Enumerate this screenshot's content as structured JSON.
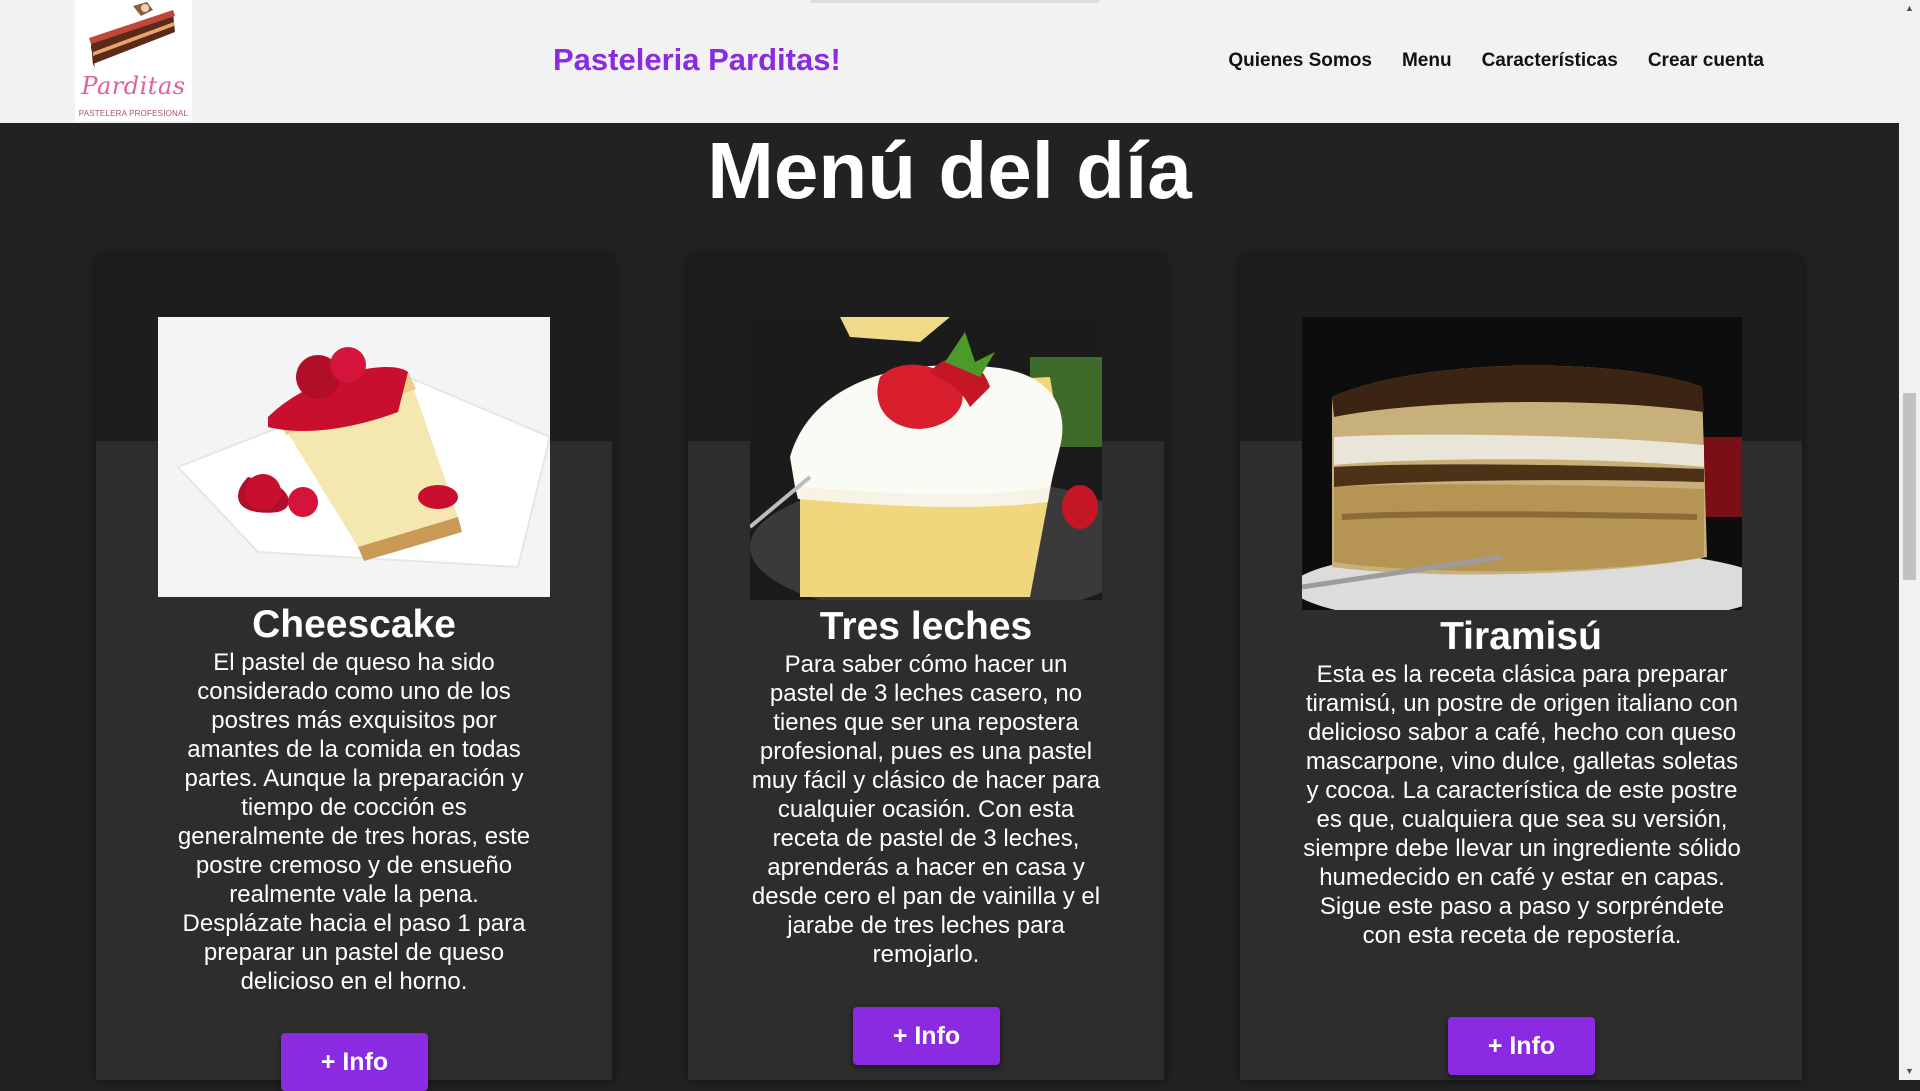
{
  "header": {
    "logo_text": "Parditas",
    "logo_subtext": "PASTELERA PROFESIONAL",
    "brand": "Pasteleria Parditas!",
    "nav": [
      "Quienes Somos",
      "Menu",
      "Características",
      "Crear cuenta"
    ]
  },
  "main": {
    "title": "Menú del día",
    "cards": [
      {
        "image": "cheesecake-photo",
        "title": "Cheescake",
        "text": "El pastel de queso ha sido considerado como uno de los postres más exquisitos por amantes de la comida en todas partes. Aunque la preparación y tiempo de cocción es generalmente de tres horas, este postre cremoso y de ensueño realmente vale la pena. Desplázate hacia el paso 1 para preparar un pastel de queso delicioso en el horno.",
        "button": "+ Info"
      },
      {
        "image": "tres-leches-photo",
        "title": "Tres leches",
        "text": "Para saber cómo hacer un pastel de 3 leches casero, no tienes que ser una repostera profesional, pues es una pastel muy fácil y clásico de hacer para cualquier ocasión. Con esta receta de pastel de 3 leches, aprenderás a hacer en casa y desde cero el pan de vainilla y el jarabe de tres leches para remojarlo.",
        "button": "+ Info"
      },
      {
        "image": "tiramisu-photo",
        "title": "Tiramisú",
        "text": "Esta es la receta clásica para preparar tiramisú, un postre de origen italiano con delicioso sabor a café, hecho con queso mascarpone, vino dulce, galletas soletas y cocoa. La característica de este postre es que, cualquiera que sea su versión, siempre debe llevar un ingrediente sólido humedecido en café y estar en capas. Sigue este paso a paso y sorpréndete con esta receta de repostería.",
        "button": "+ Info"
      }
    ]
  },
  "colors": {
    "accent": "#8a2be2",
    "page_background": "#222222",
    "card_background": "#2d2d2d",
    "header_background": "#f2f2f2",
    "logo_pink": "#e0609a"
  },
  "icons": {
    "scroll_up": "▲",
    "scroll_down": "▼"
  }
}
